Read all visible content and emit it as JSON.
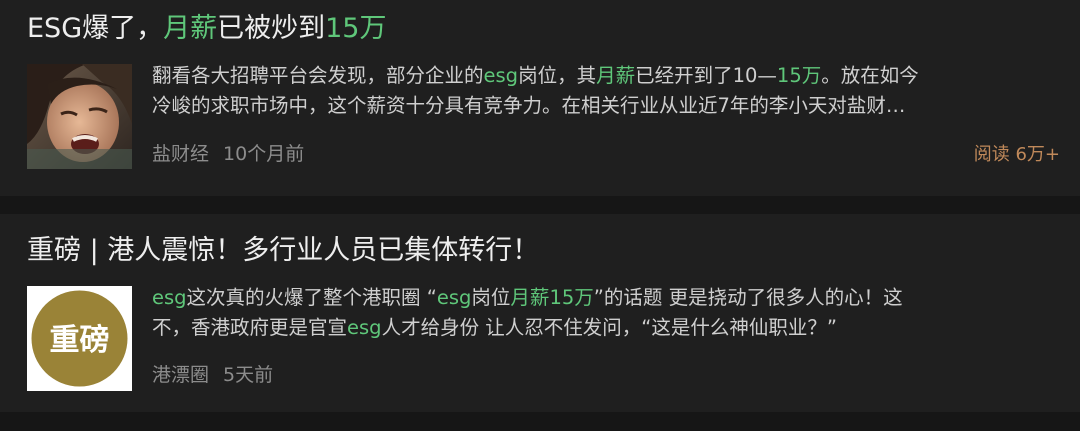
{
  "articles": [
    {
      "title": {
        "p1": "ESG爆了，",
        "p2": "月薪",
        "p3": "已被炒到",
        "p4": "15万"
      },
      "summary": {
        "l1a": "翻看各大招聘平台会发现，部分企业的",
        "l1b": "esg",
        "l1c": "岗位，其",
        "l1d": "月薪",
        "l1e": "已经开到了10—",
        "l1f": "15万",
        "l1g": "。放在如今",
        "l2": "冷峻的求职市场中，这个薪资十分具有竞争力。在相关行业从业近7年的李小天对盐财…"
      },
      "source": "盐财经",
      "time": "10个月前",
      "reads": "阅读 6万+",
      "thumbnail_icon": "crying-woman-photo"
    },
    {
      "title": {
        "full": "重磅 | 港人震惊！多行业人员已集体转行！"
      },
      "summary": {
        "l1a": "esg",
        "l1b": "这次真的火爆了整个港职圈 “",
        "l1c": "esg",
        "l1d": "岗位",
        "l1e": "月薪",
        "l1f": "15万",
        "l1g": "”的话题 更是挠动了很多人的心！这",
        "l2a": "不，香港政府更是官宣",
        "l2b": "esg",
        "l2c": "人才给身份 让人忍不住发问，“这是什么神仙职业？”"
      },
      "source": "港漂圈",
      "time": "5天前",
      "thumbnail": {
        "label": "重磅",
        "bg": "#9a8337",
        "text_color": "#ffffff"
      }
    }
  ],
  "colors": {
    "highlight": "#5fc77a",
    "reads": "#c0895a",
    "background": "#1f1f1f"
  }
}
